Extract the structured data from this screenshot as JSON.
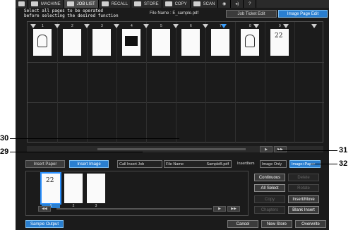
{
  "nav": {
    "tabs": [
      {
        "label": "MACHINE",
        "icon": "machine-icon"
      },
      {
        "label": "JOB LIST",
        "icon": "job-list-icon",
        "active": true
      },
      {
        "label": "RECALL",
        "icon": "recall-icon"
      },
      {
        "label": "STORE",
        "icon": "store-icon"
      },
      {
        "label": "COPY",
        "icon": "copy-icon"
      },
      {
        "label": "SCAN",
        "icon": "scan-icon"
      }
    ]
  },
  "header": {
    "instruction_line1": "Select all pages to be operated",
    "instruction_line2": "before selecting the desired function",
    "file_name": "File Name : E_sample.pdf",
    "job_ticket_edit": "Job Ticket Edit",
    "image_page_edit": "Image Page Edit"
  },
  "pages": [
    "1",
    "2",
    "3",
    "4",
    "5",
    "6",
    "7",
    "8",
    "9"
  ],
  "scroll": {
    "next": "▶",
    "last": "▶▶",
    "prev": "◀",
    "first": "◀◀"
  },
  "insert_controls": {
    "insert_paper": "Insert Paper",
    "insert_image": "Insert Image",
    "call_insert_job": "Call Insert Job",
    "file_name_label": "File Name",
    "file_name_value": "SampleB.pdf",
    "insert_item": "InsertItem",
    "image_only": "Image Only",
    "image_paper": "Image+Paper"
  },
  "insert_pages": [
    "1",
    "2",
    "3"
  ],
  "actions": {
    "continuous": "Continuous",
    "delete": "Delete",
    "all_select": "All Select",
    "rotate": "Rotate",
    "copy": "Copy",
    "insert_move": "Insert/Move",
    "chapters": "Chapters",
    "blank_insert": "Blank Insert"
  },
  "bottom": {
    "sample_output": "Sample Output",
    "cancel": "Cancel",
    "new_store": "New Store",
    "overwrite": "Overwrite"
  },
  "callouts": {
    "c30": "30",
    "c29": "29",
    "c31": "31",
    "c32": "32"
  },
  "colors": {
    "accent": "#2a7fd0",
    "background": "#1b1b1b",
    "text": "#ffffff"
  }
}
